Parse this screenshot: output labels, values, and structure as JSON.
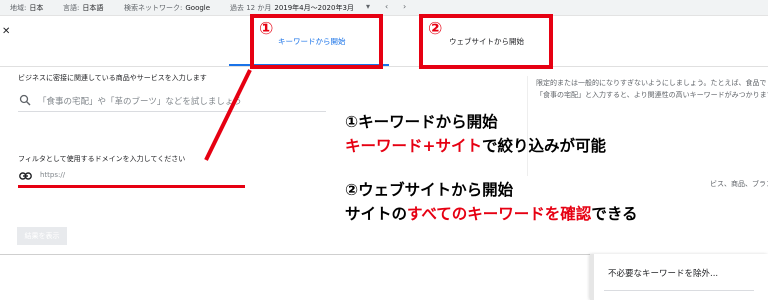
{
  "topbar": {
    "location_label": "地域:",
    "location_value": "日本",
    "language_label": "言語:",
    "language_value": "日本語",
    "network_label": "検索ネットワーク:",
    "network_value": "Google",
    "period_label": "過去 12 か月",
    "period_value": "2019年4月～2020年3月",
    "dropdown_icon": "caret-down-icon",
    "prev_icon": "chevron-left-icon",
    "next_icon": "chevron-right-icon"
  },
  "panel": {
    "close_icon": "close-icon",
    "tabs": [
      {
        "label": "キーワードから開始",
        "active": true
      },
      {
        "label": "ウェブサイトから開始",
        "active": false
      }
    ],
    "search_prompt": "ビジネスに密接に関連している商品やサービスを入力します",
    "search_placeholder": "「食事の宅配」や「革のブーツ」などを試しましょう",
    "right_hint_line1": "限定的または一般的になりすぎないようにしましょう。たとえば、食品で",
    "right_hint_line2": "「食事の宅配」と入力すると、より関連性の高いキーワードがみつかりますが、以外も",
    "right_hint_line3": "ビス、商品、ブラン",
    "domain_label": "フィルタとして使用するドメインを入力してください",
    "domain_placeholder": "https://",
    "show_results_button": "結果を表示"
  },
  "exclude_panel": {
    "label": "不必要なキーワードを除外..."
  },
  "annotations": {
    "marker1": "①",
    "marker2": "②",
    "note1_title": "①キーワードから開始",
    "note1_red": "キーワード+サイト",
    "note1_rest": "で絞り込みが可能",
    "note2_title": "②ウェブサイトから開始",
    "note2_pre": "サイトの",
    "note2_red": "すべてのキーワードを確認",
    "note2_rest": "できる"
  },
  "colors": {
    "accent_blue": "#1a73e8",
    "annotation_red": "#e60012"
  }
}
